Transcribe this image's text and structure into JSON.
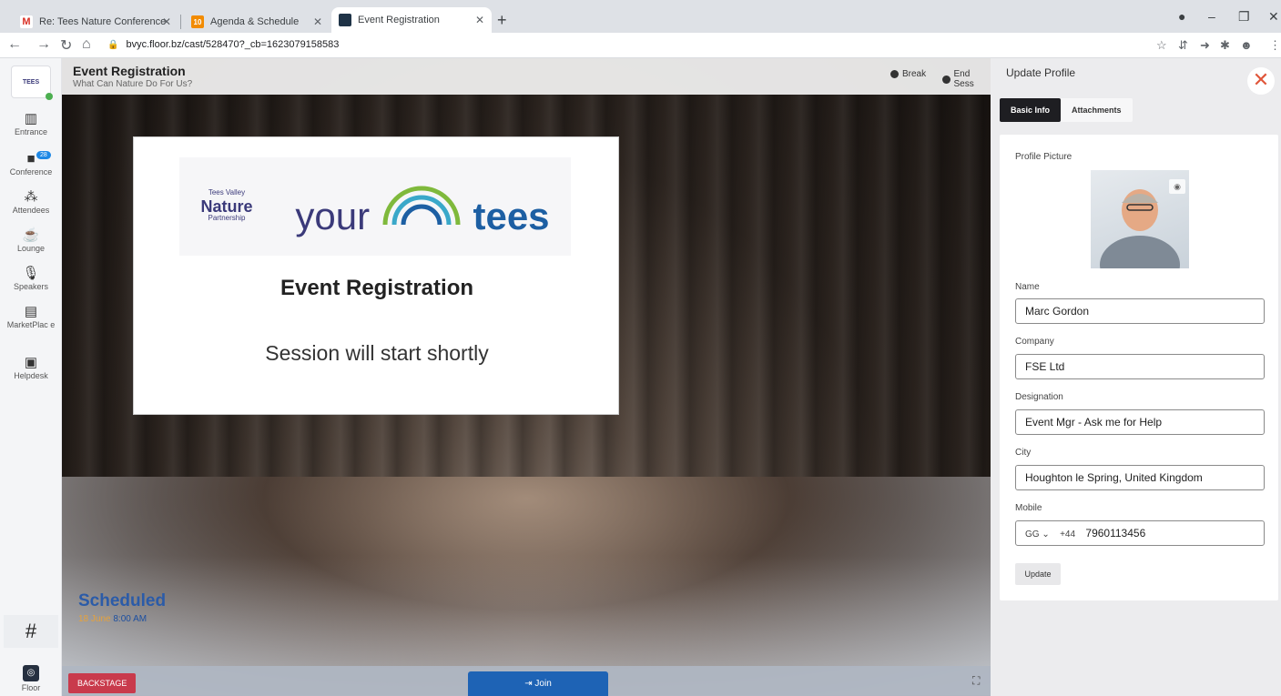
{
  "browser": {
    "tabs": [
      {
        "title": "Re: Tees Nature Conference - ma",
        "fav": "M"
      },
      {
        "title": "Agenda & Schedule",
        "fav": "10"
      },
      {
        "title": "Event Registration",
        "fav": ""
      }
    ],
    "new_tab": "+",
    "url": "bvyc.floor.bz/cast/528470?_cb=1623079158583"
  },
  "sidebar": {
    "logo": "TEES",
    "items": [
      {
        "label": "Entrance",
        "icon": "map-icon"
      },
      {
        "label": "Conference",
        "icon": "video-icon",
        "badge": "28"
      },
      {
        "label": "Attendees",
        "icon": "people-icon"
      },
      {
        "label": "Lounge",
        "icon": "lounge-icon"
      },
      {
        "label": "Speakers",
        "icon": "mic-icon"
      },
      {
        "label": "MarketPlac e",
        "icon": "store-icon"
      },
      {
        "label": "Helpdesk",
        "icon": "robot-icon"
      }
    ],
    "hash": "#",
    "floor": "Floor"
  },
  "stage": {
    "title": "Event Registration",
    "subtitle": "What Can Nature Do For Us?",
    "break_label": "Break",
    "end_label": "End Sess",
    "screen": {
      "logo_small": "Tees Valley",
      "logo_main": "Nature",
      "logo_sub": "Partnership",
      "logo_your": "your",
      "logo_tees": "tees",
      "title": "Event Registration",
      "message": "Session will start shortly"
    },
    "status": "Scheduled",
    "date": "18 June",
    "time": "8:00 AM",
    "backstage": "BACKSTAGE",
    "join": "Join"
  },
  "profile": {
    "title": "Update Profile",
    "tabs": [
      "Basic Info",
      "Attachments"
    ],
    "picture_label": "Profile Picture",
    "name_label": "Name",
    "name": "Marc Gordon",
    "company_label": "Company",
    "company": "FSE Ltd",
    "designation_label": "Designation",
    "designation": "Event Mgr - Ask me for Help",
    "city_label": "City",
    "city": "Houghton le Spring, United Kingdom",
    "mobile_label": "Mobile",
    "country": "GG",
    "dial_code": "+44",
    "mobile": "7960113456",
    "update": "Update"
  }
}
